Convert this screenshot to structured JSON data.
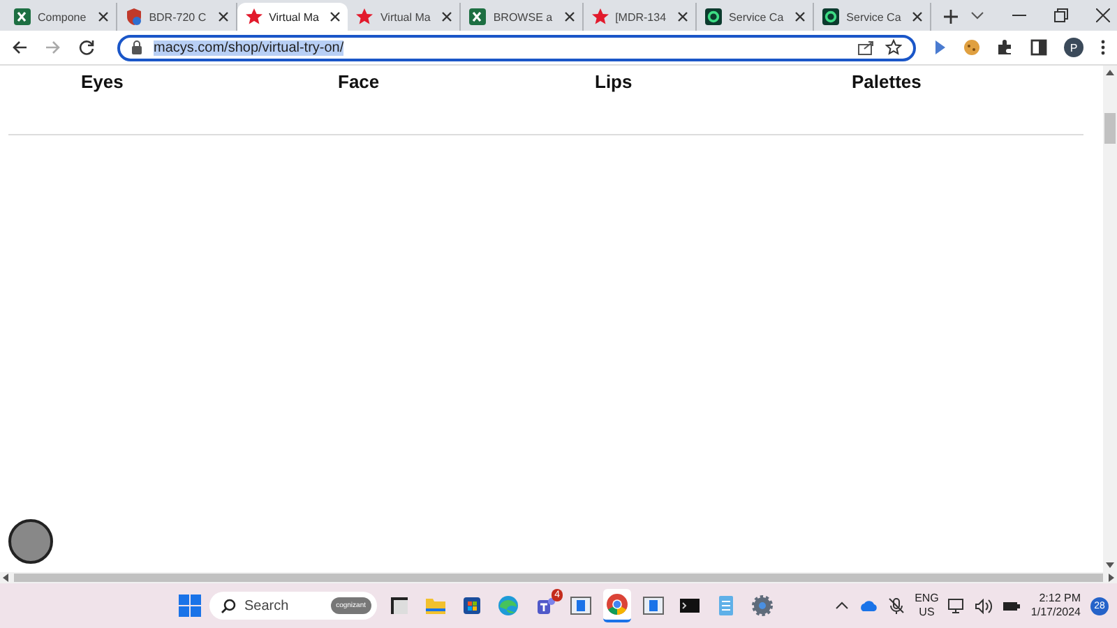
{
  "tabs": [
    {
      "title": "Compone",
      "kind": "sheet",
      "selected": false
    },
    {
      "title": "BDR-720 C",
      "kind": "shield",
      "selected": false
    },
    {
      "title": "Virtual Ma",
      "kind": "star",
      "selected": true
    },
    {
      "title": "Virtual Ma",
      "kind": "star",
      "selected": false
    },
    {
      "title": "BROWSE a",
      "kind": "sheet",
      "selected": false
    },
    {
      "title": "[MDR-134",
      "kind": "star",
      "selected": false
    },
    {
      "title": "Service Ca",
      "kind": "square",
      "selected": false
    },
    {
      "title": "Service Ca",
      "kind": "square",
      "selected": false
    }
  ],
  "toolbar": {
    "url": "macys.com/shop/virtual-try-on/",
    "url_selected": true,
    "profile_initial": "P"
  },
  "categories": [
    "Eyes",
    "Face",
    "Lips",
    "Palettes"
  ],
  "taskbar": {
    "search_placeholder": "Search",
    "search_badge": "cognizant",
    "apps": [
      {
        "kind": "widgets",
        "active": false
      },
      {
        "kind": "folder",
        "active": false
      },
      {
        "kind": "store",
        "active": false
      },
      {
        "kind": "edge",
        "active": false
      },
      {
        "kind": "teams",
        "active": false,
        "badge": "4"
      },
      {
        "kind": "window",
        "active": false
      },
      {
        "kind": "chrome",
        "active": true
      },
      {
        "kind": "window",
        "active": false
      },
      {
        "kind": "terminal",
        "active": false
      },
      {
        "kind": "notepad",
        "active": false
      },
      {
        "kind": "gear",
        "active": false
      }
    ],
    "language": "ENG",
    "region": "US",
    "time": "2:12 PM",
    "date": "1/17/2024",
    "notifications": "28"
  }
}
